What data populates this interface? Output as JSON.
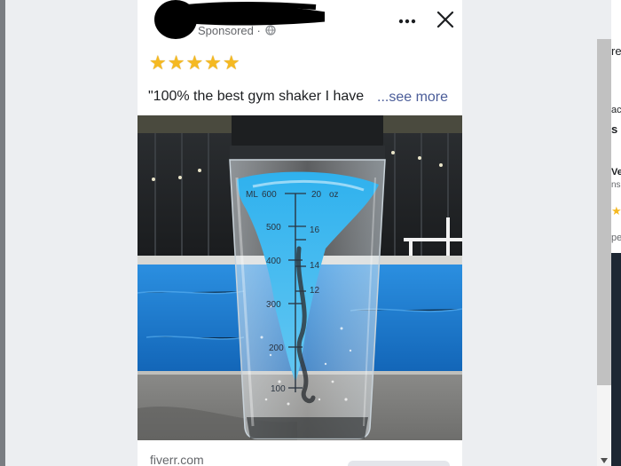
{
  "post": {
    "sponsored_label": "Sponsored ·",
    "rating": "★★★★★",
    "caption": "\"100% the best gym shaker I have",
    "see_more": "...see more",
    "domain": "fiverr.com",
    "more_icon": "more-dots-icon",
    "close_icon": "close-icon",
    "globe_icon": "globe-icon"
  },
  "image": {
    "subject": "electric protein shaker bottle with blue vortex by a pool",
    "ml_marks": [
      "600",
      "500",
      "400",
      "300",
      "200",
      "100"
    ],
    "ml_unit": "ML",
    "oz_marks": [
      "20",
      "16",
      "14",
      "12"
    ],
    "oz_unit": "oz"
  },
  "next_card_fragments": [
    "re",
    "ac",
    "s",
    "Ve",
    "ns",
    "pe"
  ],
  "colors": {
    "star": "#f5b921",
    "link": "#4b5d99",
    "liquid_blue": "#2aa7e6",
    "pool_blue": "#1e7fd4"
  }
}
